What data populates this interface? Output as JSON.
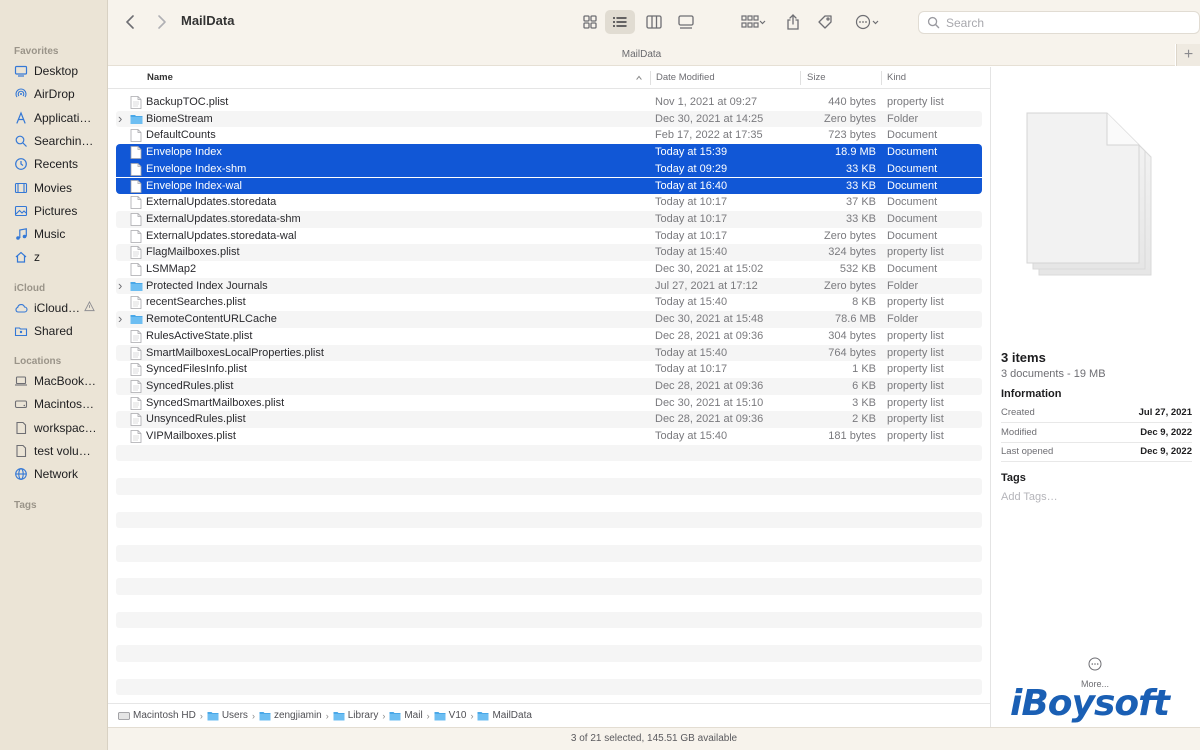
{
  "window": {
    "title": "MailData",
    "path_header": "MailData"
  },
  "toolbar": {
    "search_placeholder": "Search",
    "plus_label": "+"
  },
  "sidebar": {
    "favorites_label": "Favorites",
    "favorites": [
      {
        "label": "Desktop",
        "icon": "desktop-icon"
      },
      {
        "label": "AirDrop",
        "icon": "airdrop-icon"
      },
      {
        "label": "Applicati…",
        "icon": "applications-icon"
      },
      {
        "label": "Searchin…",
        "icon": "search-folder-icon"
      },
      {
        "label": "Recents",
        "icon": "recents-icon"
      },
      {
        "label": "Movies",
        "icon": "movies-icon"
      },
      {
        "label": "Pictures",
        "icon": "pictures-icon"
      },
      {
        "label": "Music",
        "icon": "music-icon"
      },
      {
        "label": "z",
        "icon": "home-icon"
      }
    ],
    "icloud_label": "iCloud",
    "icloud": [
      {
        "label": "iCloud…",
        "icon": "icloud-icon"
      },
      {
        "label": "Shared",
        "icon": "shared-icon"
      }
    ],
    "locations_label": "Locations",
    "locations": [
      {
        "label": "MacBook…",
        "icon": "laptop-icon"
      },
      {
        "label": "Macintos…",
        "icon": "disk-icon"
      },
      {
        "label": "workspac…",
        "icon": "volume-icon"
      },
      {
        "label": "test volu…",
        "icon": "volume-icon"
      },
      {
        "label": "Network",
        "icon": "network-icon"
      }
    ],
    "tags_label": "Tags"
  },
  "columns": {
    "name": "Name",
    "date": "Date Modified",
    "size": "Size",
    "kind": "Kind"
  },
  "files": [
    {
      "name": "BackupTOC.plist",
      "date": "Nov 1, 2021 at 09:27",
      "size": "440 bytes",
      "kind": "property list",
      "type": "plist",
      "selected": false,
      "folder": false
    },
    {
      "name": "BiomeStream",
      "date": "Dec 30, 2021 at 14:25",
      "size": "Zero bytes",
      "kind": "Folder",
      "type": "folder",
      "selected": false,
      "folder": true
    },
    {
      "name": "DefaultCounts",
      "date": "Feb 17, 2022 at 17:35",
      "size": "723 bytes",
      "kind": "Document",
      "type": "doc",
      "selected": false,
      "folder": false
    },
    {
      "name": "Envelope Index",
      "date": "Today at 15:39",
      "size": "18.9 MB",
      "kind": "Document",
      "type": "doc",
      "selected": true,
      "folder": false
    },
    {
      "name": "Envelope Index-shm",
      "date": "Today at 09:29",
      "size": "33 KB",
      "kind": "Document",
      "type": "doc",
      "selected": true,
      "folder": false
    },
    {
      "name": "Envelope Index-wal",
      "date": "Today at 16:40",
      "size": "33 KB",
      "kind": "Document",
      "type": "doc",
      "selected": true,
      "folder": false
    },
    {
      "name": "ExternalUpdates.storedata",
      "date": "Today at 10:17",
      "size": "37 KB",
      "kind": "Document",
      "type": "doc",
      "selected": false,
      "folder": false
    },
    {
      "name": "ExternalUpdates.storedata-shm",
      "date": "Today at 10:17",
      "size": "33 KB",
      "kind": "Document",
      "type": "doc",
      "selected": false,
      "folder": false
    },
    {
      "name": "ExternalUpdates.storedata-wal",
      "date": "Today at 10:17",
      "size": "Zero bytes",
      "kind": "Document",
      "type": "doc",
      "selected": false,
      "folder": false
    },
    {
      "name": "FlagMailboxes.plist",
      "date": "Today at 15:40",
      "size": "324 bytes",
      "kind": "property list",
      "type": "plist",
      "selected": false,
      "folder": false
    },
    {
      "name": "LSMMap2",
      "date": "Dec 30, 2021 at 15:02",
      "size": "532 KB",
      "kind": "Document",
      "type": "doc",
      "selected": false,
      "folder": false
    },
    {
      "name": "Protected Index Journals",
      "date": "Jul 27, 2021 at 17:12",
      "size": "Zero bytes",
      "kind": "Folder",
      "type": "folder",
      "selected": false,
      "folder": true
    },
    {
      "name": "recentSearches.plist",
      "date": "Today at 15:40",
      "size": "8 KB",
      "kind": "property list",
      "type": "plist",
      "selected": false,
      "folder": false
    },
    {
      "name": "RemoteContentURLCache",
      "date": "Dec 30, 2021 at 15:48",
      "size": "78.6 MB",
      "kind": "Folder",
      "type": "folder",
      "selected": false,
      "folder": true
    },
    {
      "name": "RulesActiveState.plist",
      "date": "Dec 28, 2021 at 09:36",
      "size": "304 bytes",
      "kind": "property list",
      "type": "plist",
      "selected": false,
      "folder": false
    },
    {
      "name": "SmartMailboxesLocalProperties.plist",
      "date": "Today at 15:40",
      "size": "764 bytes",
      "kind": "property list",
      "type": "plist",
      "selected": false,
      "folder": false
    },
    {
      "name": "SyncedFilesInfo.plist",
      "date": "Today at 10:17",
      "size": "1 KB",
      "kind": "property list",
      "type": "plist",
      "selected": false,
      "folder": false
    },
    {
      "name": "SyncedRules.plist",
      "date": "Dec 28, 2021 at 09:36",
      "size": "6 KB",
      "kind": "property list",
      "type": "plist",
      "selected": false,
      "folder": false
    },
    {
      "name": "SyncedSmartMailboxes.plist",
      "date": "Dec 30, 2021 at 15:10",
      "size": "3 KB",
      "kind": "property list",
      "type": "plist",
      "selected": false,
      "folder": false
    },
    {
      "name": "UnsyncedRules.plist",
      "date": "Dec 28, 2021 at 09:36",
      "size": "2 KB",
      "kind": "property list",
      "type": "plist",
      "selected": false,
      "folder": false
    },
    {
      "name": "VIPMailboxes.plist",
      "date": "Today at 15:40",
      "size": "181 bytes",
      "kind": "property list",
      "type": "plist",
      "selected": false,
      "folder": false
    }
  ],
  "breadcrumb": [
    {
      "label": "Macintosh HD",
      "icon": "disk-icon"
    },
    {
      "label": "Users",
      "icon": "folder-icon"
    },
    {
      "label": "zengjiamin",
      "icon": "folder-icon"
    },
    {
      "label": "Library",
      "icon": "folder-icon"
    },
    {
      "label": "Mail",
      "icon": "folder-icon"
    },
    {
      "label": "V10",
      "icon": "folder-icon"
    },
    {
      "label": "MailData",
      "icon": "folder-icon"
    }
  ],
  "status": "3 of 21 selected, 145.51 GB available",
  "preview": {
    "title": "3 items",
    "subtitle": "3 documents - 19 MB",
    "info_label": "Information",
    "info": [
      {
        "key": "Created",
        "value": "Jul 27, 2021"
      },
      {
        "key": "Modified",
        "value": "Dec 9, 2022"
      },
      {
        "key": "Last opened",
        "value": "Dec 9, 2022"
      }
    ],
    "tags_label": "Tags",
    "add_tags": "Add Tags…",
    "more_label": "More..."
  },
  "watermark": "iBoysoft",
  "colors": {
    "selection": "#1157d6",
    "sidebar": "#ebe4d6",
    "folder": "#4aa8e8"
  }
}
